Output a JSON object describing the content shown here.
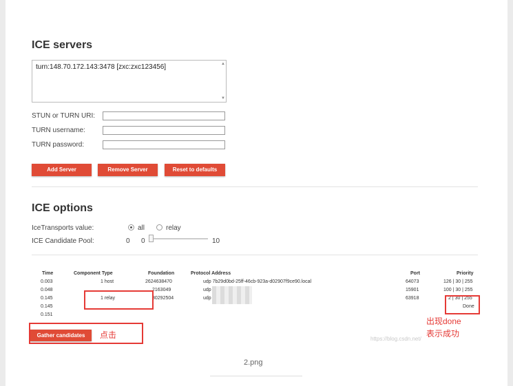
{
  "ice_servers": {
    "title": "ICE servers",
    "selected_server": "turn:148.70.172.143:3478 [zxc:zxc123456]",
    "stun_label": "STUN or TURN URI:",
    "username_label": "TURN username:",
    "password_label": "TURN password:",
    "stun_value": "",
    "username_value": "",
    "password_value": "",
    "buttons": {
      "add": "Add Server",
      "remove": "Remove Server",
      "reset": "Reset to defaults"
    }
  },
  "ice_options": {
    "title": "ICE options",
    "transports_label": "IceTransports value:",
    "transport_all": "all",
    "transport_relay": "relay",
    "transport_selected": "all",
    "pool_label": "ICE Candidate Pool:",
    "pool_value": "0",
    "pool_min": "0",
    "pool_max": "10"
  },
  "candidates": {
    "headers": {
      "time": "Time",
      "component_type": "Component Type",
      "foundation": "Foundation",
      "protocol_address": "Protocol Address",
      "port": "Port",
      "priority": "Priority"
    },
    "rows": [
      {
        "time": "0.003",
        "component_type": "1 host",
        "foundation": "2624638470",
        "protocol_address": "udp 7b29d0bd-25ff-46cb-923a-d02907f9ce90.local",
        "port": "64073",
        "priority": "126 | 30 | 255"
      },
      {
        "time": "0.048",
        "component_type": "",
        "foundation": "2163049",
        "protocol_address": "udp",
        "port": "15901",
        "priority": "100 | 30 | 255"
      },
      {
        "time": "0.145",
        "component_type": "1 relay",
        "foundation": "80292504",
        "protocol_address": "udp",
        "port": "63918",
        "priority": "2 | 30 | 255"
      },
      {
        "time": "0.145",
        "component_type": "",
        "foundation": "",
        "protocol_address": "",
        "port": "",
        "priority": "Done"
      },
      {
        "time": "0.151",
        "component_type": "",
        "foundation": "",
        "protocol_address": "",
        "port": "",
        "priority": ""
      }
    ],
    "gather_button": "Gather candidates"
  },
  "annotations": {
    "click": "点击",
    "done_line1": "出现done",
    "done_line2": "表示成功"
  },
  "watermark": "https://blog.csdn.net/",
  "caption": "2.png",
  "colors": {
    "accent": "#e04b36",
    "annotation": "#e53935"
  }
}
